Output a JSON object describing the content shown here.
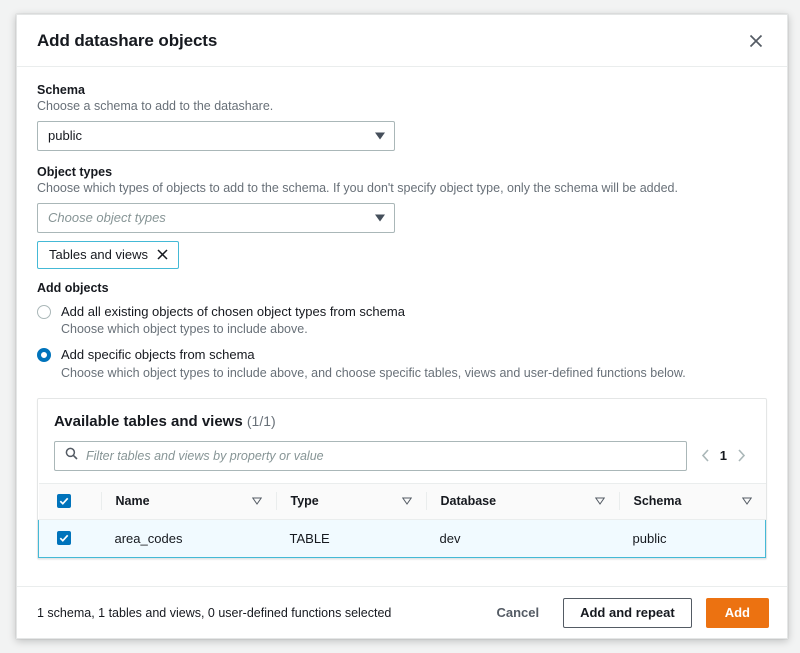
{
  "dialog": {
    "title": "Add datashare objects",
    "close_icon": "close-icon"
  },
  "schema_field": {
    "label": "Schema",
    "description": "Choose a schema to add to the datashare.",
    "value": "public"
  },
  "object_types_field": {
    "label": "Object types",
    "description": "Choose which types of objects to add to the schema. If you don't specify object type, only the schema will be added.",
    "placeholder": "Choose object types",
    "tokens": [
      {
        "label": "Tables and views"
      }
    ]
  },
  "add_objects": {
    "label": "Add objects",
    "options": [
      {
        "title": "Add all existing objects of chosen object types from schema",
        "description": "Choose which object types to include above.",
        "selected": false
      },
      {
        "title": "Add specific objects from schema",
        "description": "Choose which object types to include above, and choose specific tables, views and user-defined functions below.",
        "selected": true
      }
    ]
  },
  "table_panel": {
    "title": "Available tables and views",
    "count": "(1/1)",
    "filter_placeholder": "Filter tables and views by property or value",
    "pagination": {
      "previous_icon": "chevron-left-icon",
      "current_page": "1",
      "next_icon": "chevron-right-icon"
    },
    "columns": [
      "Name",
      "Type",
      "Database",
      "Schema"
    ],
    "rows": [
      {
        "selected": true,
        "name": "area_codes",
        "type": "TABLE",
        "database": "dev",
        "schema": "public"
      }
    ]
  },
  "footer": {
    "status": "1 schema, 1 tables and views, 0 user-defined functions selected",
    "cancel_label": "Cancel",
    "add_and_repeat_label": "Add and repeat",
    "add_label": "Add"
  },
  "colors": {
    "primary_button": "#ec7211",
    "accent_blue": "#0073bb",
    "selection_border": "#44b9d6",
    "selection_bg": "#f1faff",
    "text": "#16191f",
    "muted_text": "#687078"
  }
}
